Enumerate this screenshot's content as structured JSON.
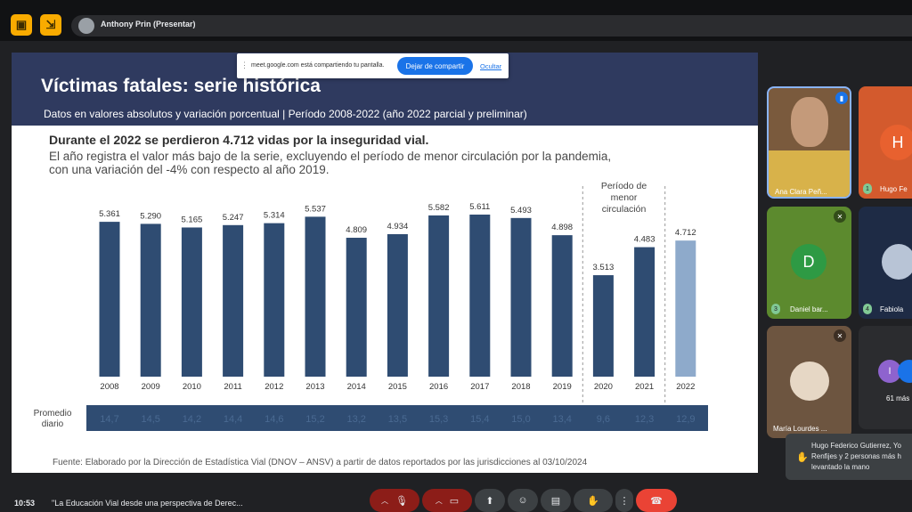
{
  "meet": {
    "presenter_label": "Anthony Prin (Presentar)",
    "share_banner": {
      "text": "meet.google.com está compartiendo tu pantalla.",
      "stop_label": "Dejar de compartir",
      "hide_label": "Ocultar"
    },
    "clock": "10:53",
    "meeting_title": "\"La Educación Vial desde una perspectiva de Derec...",
    "participants": [
      {
        "name": "Ana Clara Peñ..."
      },
      {
        "name": "Hugo Fe",
        "initial": "H",
        "badge": "1"
      },
      {
        "name": "Daniel bar...",
        "initial": "D",
        "badge": "3"
      },
      {
        "name": "Fabiola",
        "badge": "4"
      },
      {
        "name": "María Lourdes ..."
      },
      {
        "name": "61 más",
        "initial": "I"
      }
    ],
    "raise_hand_notice": {
      "line1": "Hugo Federico Gutierrez, Yo",
      "line2": "Renfijes y 2 personas más h",
      "line3": "levantado la mano"
    },
    "colors": {
      "accent": "#f9ab00",
      "end_call": "#ea4335"
    }
  },
  "slide": {
    "title": "Víctimas fatales: serie histórica",
    "subtitle": "Datos en valores absolutos y variación porcentual | Período 2008-2022 (año 2022 parcial y preliminar)",
    "headline": "Durante el 2022 se perdieron 4.712 vidas por la inseguridad vial.",
    "description_line1": "El año registra el valor más bajo de la serie, excluyendo el período de menor circulación por la pandemia,",
    "description_line2": "con una variación del -4% con respecto al año 2019.",
    "avg_label": "Promedio diario",
    "footnote": "Fuente: Elaborado por la Dirección de Estadística Vial (DNOV – ANSV) a partir de datos reportados por las jurisdicciones al 03/10/2024"
  },
  "chart_data": {
    "type": "bar",
    "categories": [
      "2008",
      "2009",
      "2010",
      "2011",
      "2012",
      "2013",
      "2014",
      "2015",
      "2016",
      "2017",
      "2018",
      "2019",
      "2020",
      "2021",
      "2022"
    ],
    "values": [
      5361,
      5290,
      5165,
      5247,
      5314,
      5537,
      4809,
      4934,
      5582,
      5611,
      5493,
      4898,
      3513,
      4483,
      4712
    ],
    "value_labels": [
      "5.361",
      "5.290",
      "5.165",
      "5.247",
      "5.314",
      "5.537",
      "4.809",
      "4.934",
      "5.582",
      "5.611",
      "5.493",
      "4.898",
      "3.513",
      "4.483",
      "4.712"
    ],
    "daily_average": [
      "14,7",
      "14,5",
      "14,2",
      "14,4",
      "14,6",
      "15,2",
      "13,2",
      "13,5",
      "15,3",
      "15,4",
      "15,0",
      "13,4",
      "9,6",
      "12,3",
      "12,9"
    ],
    "annotation": "Período de menor circulación",
    "annotation_lines": [
      "Período de",
      "menor",
      "circulación"
    ],
    "ylim": [
      0,
      5611
    ],
    "grid": false,
    "colors": {
      "bar": "#2f4c72",
      "bar_partial": "#8eaacb"
    }
  }
}
